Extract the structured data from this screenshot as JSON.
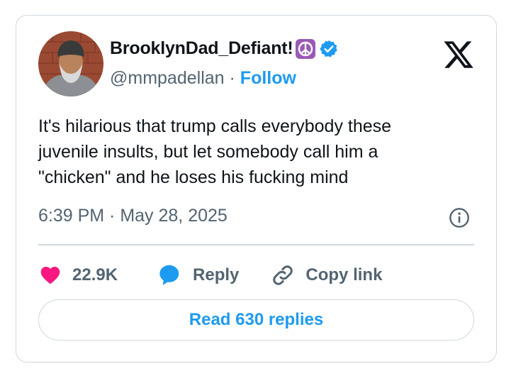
{
  "user": {
    "display_name": "BrooklynDad_Defiant!",
    "handle": "@mmpadellan",
    "separator": "·",
    "follow_label": "Follow"
  },
  "icons": {
    "avatar": "avatar-photo",
    "peace": "peace-emoji",
    "verified": "verified-badge-icon",
    "brand": "x-logo",
    "info": "info-icon",
    "like": "heart-icon",
    "reply": "reply-bubble-icon",
    "copy": "link-icon"
  },
  "colors": {
    "accent": "#1d9bf0",
    "heart": "#f91880",
    "muted": "#536471",
    "peace_bg": "#9b59b6"
  },
  "tweet": {
    "lines": [
      "It's hilarious that trump calls everybody these",
      "juvenile insults, but let somebody call him a",
      "\"chicken\" and he loses his fucking mind"
    ],
    "timestamp": "6:39 PM · May 28, 2025"
  },
  "actions": {
    "likes": "22.9K",
    "reply_label": "Reply",
    "copy_label": "Copy link"
  },
  "read_replies_label": "Read 630 replies"
}
